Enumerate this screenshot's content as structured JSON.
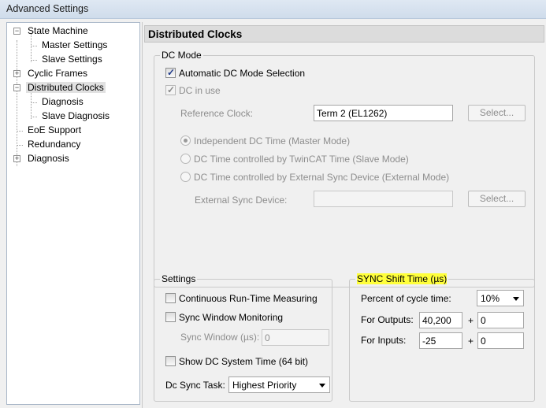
{
  "window": {
    "title": "Advanced Settings"
  },
  "tree": {
    "state_machine": "State Machine",
    "master_settings": "Master Settings",
    "slave_settings": "Slave Settings",
    "cyclic_frames": "Cyclic Frames",
    "distributed_clocks": "Distributed Clocks",
    "diagnosis_child": "Diagnosis",
    "slave_diagnosis": "Slave Diagnosis",
    "eoe_support": "EoE Support",
    "redundancy": "Redundancy",
    "diagnosis": "Diagnosis",
    "expander_minus": "−",
    "expander_plus": "+"
  },
  "panel": {
    "title": "Distributed Clocks"
  },
  "dc_mode": {
    "legend": "DC Mode",
    "automatic_label": "Automatic DC Mode Selection",
    "automatic_checked": true,
    "dc_in_use_label": "DC in use",
    "dc_in_use_checked": true,
    "reference_clock_label": "Reference Clock:",
    "reference_clock_value": "Term 2 (EL1262)",
    "select_label": "Select...",
    "radio_independent": "Independent DC Time (Master Mode)",
    "radio_twincat": "DC Time controlled by TwinCAT Time (Slave Mode)",
    "radio_external": "DC Time controlled by External Sync Device (External Mode)",
    "selected_radio": "independent",
    "external_sync_label": "External Sync Device:",
    "external_sync_value": "",
    "select_label_2": "Select..."
  },
  "settings": {
    "legend": "Settings",
    "continuous_label": "Continuous Run-Time Measuring",
    "sync_window_label": "Sync Window Monitoring",
    "sync_window_field_label": "Sync Window (µs):",
    "sync_window_value": "0",
    "show_dc_label": "Show DC System Time (64 bit)",
    "dc_sync_task_label": "Dc Sync Task:",
    "dc_sync_task_value": "Highest Priority"
  },
  "sync_shift": {
    "legend": "SYNC Shift Time (µs)",
    "highlight_color": "#ffff3a",
    "percent_label": "Percent of cycle time:",
    "percent_value": "10%",
    "outputs_label": "For Outputs:",
    "outputs_value": "40,200",
    "outputs_offset": "0",
    "inputs_label": "For Inputs:",
    "inputs_value": "-25",
    "inputs_offset": "0",
    "plus": "+"
  }
}
